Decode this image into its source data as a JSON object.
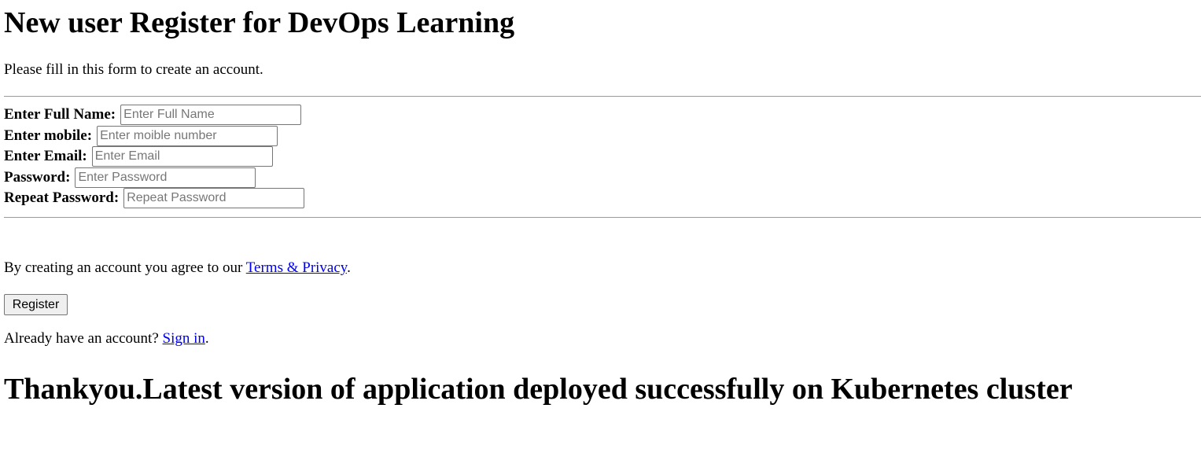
{
  "header": {
    "title": "New user Register for DevOps Learning",
    "intro": "Please fill in this form to create an account."
  },
  "form": {
    "fields": [
      {
        "label": "Enter Full Name:",
        "placeholder": "Enter Full Name",
        "value": ""
      },
      {
        "label": "Enter mobile:",
        "placeholder": "Enter moible number",
        "value": ""
      },
      {
        "label": "Enter Email:",
        "placeholder": "Enter Email",
        "value": ""
      },
      {
        "label": "Password:",
        "placeholder": "Enter Password",
        "value": ""
      },
      {
        "label": "Repeat Password:",
        "placeholder": "Repeat Password",
        "value": ""
      }
    ],
    "agree_prefix": "By creating an account you agree to our ",
    "agree_link": "Terms & Privacy",
    "agree_suffix": ".",
    "register_label": "Register",
    "signin_prefix": "Already have an account? ",
    "signin_link": "Sign in",
    "signin_suffix": "."
  },
  "footer": {
    "message": "Thankyou.Latest version of application deployed successfully on Kubernetes cluster"
  }
}
